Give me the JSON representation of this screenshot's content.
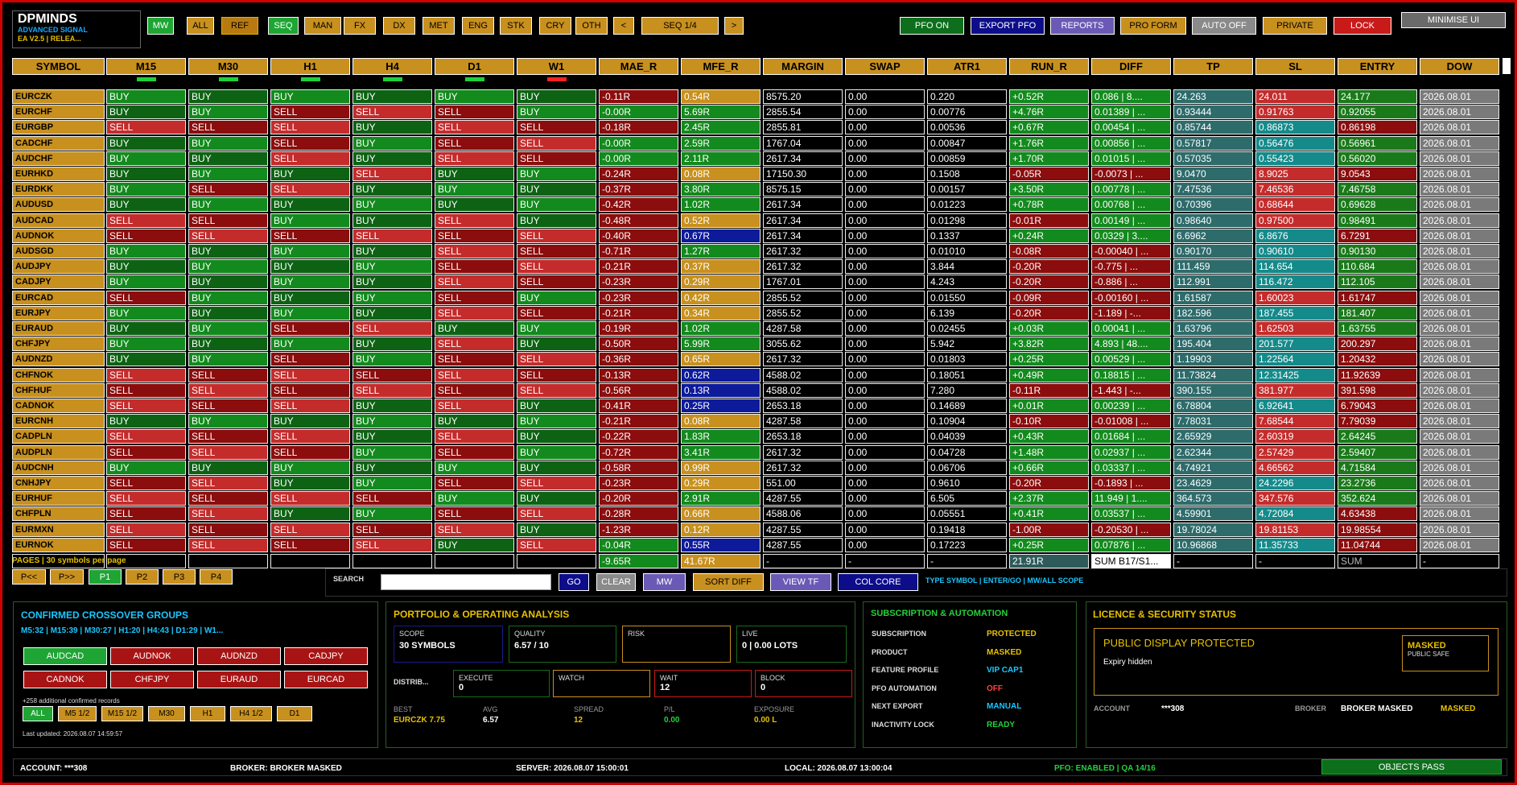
{
  "app": {
    "name": "DPMINDS",
    "sub": "ADVANCED SIGNAL",
    "ver": "EA V2.5 | RELEA..."
  },
  "filters": [
    "MW",
    "ALL",
    "REF",
    "SEQ",
    "MAN",
    "FX",
    "DX",
    "MET",
    "ENG",
    "STK",
    "CRY",
    "OTH",
    "<",
    "SEQ 1/4",
    ">"
  ],
  "toolbar": {
    "pfo": "PFO ON",
    "export": "EXPORT PFO",
    "reports": "REPORTS",
    "proform": "PRO FORM",
    "auto": "AUTO OFF",
    "private": "PRIVATE",
    "lock": "LOCK",
    "minimise": "MINIMISE UI"
  },
  "columns": [
    "SYMBOL",
    "M15",
    "M30",
    "H1",
    "H4",
    "D1",
    "W1",
    "MAE_R",
    "MFE_R",
    "MARGIN",
    "SWAP",
    "ATR1",
    "RUN_R",
    "DIFF",
    "TP",
    "SL",
    "ENTRY",
    "DOW"
  ],
  "indicators": [
    "green",
    "green",
    "green",
    "green",
    "green",
    "red"
  ],
  "rows": [
    [
      "EURCZK",
      "B",
      "B",
      "B",
      "B",
      "B",
      "B",
      "-0.11R",
      "0.54R",
      "8575.20",
      "0.00",
      "0.220",
      "+0.52R",
      "0.086 | 8....",
      "24.263",
      "24.011",
      "24.177",
      "2026.08.01"
    ],
    [
      "EURCHF",
      "B",
      "B",
      "S",
      "S",
      "S",
      "B",
      "-0.00R",
      "5.69R",
      "2855.54",
      "0.00",
      "0.00776",
      "+4.76R",
      "0.01389 | ...",
      "0.93444",
      "0.91763",
      "0.92055",
      "2026.08.01"
    ],
    [
      "EURGBP",
      "S",
      "S",
      "S",
      "B",
      "S",
      "S",
      "-0.18R",
      "2.45R",
      "2855.81",
      "0.00",
      "0.00536",
      "+0.67R",
      "0.00454 | ...",
      "0.85744",
      "0.86873",
      "0.86198",
      "2026.08.01"
    ],
    [
      "CADCHF",
      "B",
      "B",
      "S",
      "B",
      "S",
      "S",
      "-0.00R",
      "2.59R",
      "1767.04",
      "0.00",
      "0.00847",
      "+1.76R",
      "0.00856 | ...",
      "0.57817",
      "0.56476",
      "0.56961",
      "2026.08.01"
    ],
    [
      "AUDCHF",
      "B",
      "B",
      "S",
      "B",
      "S",
      "S",
      "-0.00R",
      "2.11R",
      "2617.34",
      "0.00",
      "0.00859",
      "+1.70R",
      "0.01015 | ...",
      "0.57035",
      "0.55423",
      "0.56020",
      "2026.08.01"
    ],
    [
      "EURHKD",
      "B",
      "B",
      "B",
      "S",
      "B",
      "B",
      "-0.24R",
      "0.08R",
      "17150.30",
      "0.00",
      "0.1508",
      "-0.05R",
      "-0.0073 | ...",
      "9.0470",
      "8.9025",
      "9.0543",
      "2026.08.01"
    ],
    [
      "EURDKK",
      "B",
      "S",
      "S",
      "B",
      "B",
      "B",
      "-0.37R",
      "3.80R",
      "8575.15",
      "0.00",
      "0.00157",
      "+3.50R",
      "0.00778 | ...",
      "7.47536",
      "7.46536",
      "7.46758",
      "2026.08.01"
    ],
    [
      "AUDUSD",
      "B",
      "B",
      "B",
      "B",
      "B",
      "B",
      "-0.42R",
      "1.02R",
      "2617.34",
      "0.00",
      "0.01223",
      "+0.78R",
      "0.00768 | ...",
      "0.70396",
      "0.68644",
      "0.69628",
      "2026.08.01"
    ],
    [
      "AUDCAD",
      "S",
      "S",
      "B",
      "B",
      "S",
      "B",
      "-0.48R",
      "0.52R",
      "2617.34",
      "0.00",
      "0.01298",
      "-0.01R",
      "0.00149 | ...",
      "0.98640",
      "0.97500",
      "0.98491",
      "2026.08.01"
    ],
    [
      "AUDNOK",
      "S",
      "S",
      "S",
      "S",
      "S",
      "S",
      "-0.40R",
      "0.67R",
      "2617.34",
      "0.00",
      "0.1337",
      "+0.24R",
      "0.0329 | 3....",
      "6.6962",
      "6.8676",
      "6.7291",
      "2026.08.01"
    ],
    [
      "AUDSGD",
      "B",
      "B",
      "B",
      "B",
      "S",
      "S",
      "-0.71R",
      "1.27R",
      "2617.32",
      "0.00",
      "0.01010",
      "-0.08R",
      "-0.00040 | ...",
      "0.90170",
      "0.90610",
      "0.90130",
      "2026.08.01"
    ],
    [
      "AUDJPY",
      "B",
      "B",
      "B",
      "B",
      "S",
      "S",
      "-0.21R",
      "0.37R",
      "2617.32",
      "0.00",
      "3.844",
      "-0.20R",
      "-0.775 | ...",
      "111.459",
      "114.654",
      "110.684",
      "2026.08.01"
    ],
    [
      "CADJPY",
      "B",
      "B",
      "B",
      "B",
      "S",
      "S",
      "-0.23R",
      "0.29R",
      "1767.01",
      "0.00",
      "4.243",
      "-0.20R",
      "-0.886 | ...",
      "112.991",
      "116.472",
      "112.105",
      "2026.08.01"
    ],
    [
      "EURCAD",
      "S",
      "B",
      "B",
      "B",
      "S",
      "B",
      "-0.23R",
      "0.42R",
      "2855.52",
      "0.00",
      "0.01550",
      "-0.09R",
      "-0.00160 | ...",
      "1.61587",
      "1.60023",
      "1.61747",
      "2026.08.01"
    ],
    [
      "EURJPY",
      "B",
      "B",
      "B",
      "B",
      "S",
      "S",
      "-0.21R",
      "0.34R",
      "2855.52",
      "0.00",
      "6.139",
      "-0.20R",
      "-1.189 | -...",
      "182.596",
      "187.455",
      "181.407",
      "2026.08.01"
    ],
    [
      "EURAUD",
      "B",
      "B",
      "S",
      "S",
      "B",
      "B",
      "-0.19R",
      "1.02R",
      "4287.58",
      "0.00",
      "0.02455",
      "+0.03R",
      "0.00041 | ...",
      "1.63796",
      "1.62503",
      "1.63755",
      "2026.08.01"
    ],
    [
      "CHFJPY",
      "B",
      "B",
      "B",
      "B",
      "S",
      "B",
      "-0.50R",
      "5.99R",
      "3055.62",
      "0.00",
      "5.942",
      "+3.82R",
      "4.893 | 48....",
      "195.404",
      "201.577",
      "200.297",
      "2026.08.01"
    ],
    [
      "AUDNZD",
      "B",
      "B",
      "S",
      "B",
      "S",
      "S",
      "-0.36R",
      "0.65R",
      "2617.32",
      "0.00",
      "0.01803",
      "+0.25R",
      "0.00529 | ...",
      "1.19903",
      "1.22564",
      "1.20432",
      "2026.08.01"
    ],
    [
      "CHFNOK",
      "S",
      "S",
      "S",
      "S",
      "S",
      "S",
      "-0.13R",
      "0.62R",
      "4588.02",
      "0.00",
      "0.18051",
      "+0.49R",
      "0.18815 | ...",
      "11.73824",
      "12.31425",
      "11.92639",
      "2026.08.01"
    ],
    [
      "CHFHUF",
      "S",
      "S",
      "S",
      "S",
      "S",
      "S",
      "-0.56R",
      "0.13R",
      "4588.02",
      "0.00",
      "7.280",
      "-0.11R",
      "-1.443 | -...",
      "390.155",
      "381.977",
      "391.598",
      "2026.08.01"
    ],
    [
      "CADNOK",
      "S",
      "S",
      "S",
      "B",
      "S",
      "B",
      "-0.41R",
      "0.25R",
      "2653.18",
      "0.00",
      "0.14689",
      "+0.01R",
      "0.00239 | ...",
      "6.78804",
      "6.92641",
      "6.79043",
      "2026.08.01"
    ],
    [
      "EURCNH",
      "B",
      "B",
      "B",
      "B",
      "B",
      "B",
      "-0.21R",
      "0.08R",
      "4287.58",
      "0.00",
      "0.10904",
      "-0.10R",
      "-0.01008 | ...",
      "7.78031",
      "7.68544",
      "7.79039",
      "2026.08.01"
    ],
    [
      "CADPLN",
      "S",
      "S",
      "S",
      "B",
      "S",
      "B",
      "-0.22R",
      "1.83R",
      "2653.18",
      "0.00",
      "0.04039",
      "+0.43R",
      "0.01684 | ...",
      "2.65929",
      "2.60319",
      "2.64245",
      "2026.08.01"
    ],
    [
      "AUDPLN",
      "S",
      "S",
      "S",
      "B",
      "S",
      "B",
      "-0.72R",
      "3.41R",
      "2617.32",
      "0.00",
      "0.04728",
      "+1.48R",
      "0.02937 | ...",
      "2.62344",
      "2.57429",
      "2.59407",
      "2026.08.01"
    ],
    [
      "AUDCNH",
      "B",
      "B",
      "B",
      "B",
      "B",
      "B",
      "-0.58R",
      "0.99R",
      "2617.32",
      "0.00",
      "0.06706",
      "+0.66R",
      "0.03337 | ...",
      "4.74921",
      "4.66562",
      "4.71584",
      "2026.08.01"
    ],
    [
      "CNHJPY",
      "S",
      "S",
      "B",
      "B",
      "S",
      "S",
      "-0.23R",
      "0.29R",
      "551.00",
      "0.00",
      "0.9610",
      "-0.20R",
      "-0.1893 | ...",
      "23.4629",
      "24.2296",
      "23.2736",
      "2026.08.01"
    ],
    [
      "EURHUF",
      "S",
      "S",
      "S",
      "S",
      "B",
      "B",
      "-0.20R",
      "2.91R",
      "4287.55",
      "0.00",
      "6.505",
      "+2.37R",
      "11.949 | 1....",
      "364.573",
      "347.576",
      "352.624",
      "2026.08.01"
    ],
    [
      "CHFPLN",
      "S",
      "S",
      "B",
      "B",
      "S",
      "S",
      "-0.28R",
      "0.66R",
      "4588.06",
      "0.00",
      "0.05551",
      "+0.41R",
      "0.03537 | ...",
      "4.59901",
      "4.72084",
      "4.63438",
      "2026.08.01"
    ],
    [
      "EURMXN",
      "S",
      "S",
      "S",
      "S",
      "S",
      "B",
      "-1.23R",
      "0.12R",
      "4287.55",
      "0.00",
      "0.19418",
      "-1.00R",
      "-0.20530 | ...",
      "19.78024",
      "19.81153",
      "19.98554",
      "2026.08.01"
    ],
    [
      "EURNOK",
      "S",
      "S",
      "S",
      "S",
      "B",
      "S",
      "-0.04R",
      "0.55R",
      "4287.55",
      "0.00",
      "0.17223",
      "+0.25R",
      "0.07876 | ...",
      "10.96868",
      "11.35733",
      "11.04744",
      "2026.08.01"
    ]
  ],
  "mfe_blue": [
    9,
    18,
    19,
    20,
    29
  ],
  "sl_teal": [
    2,
    3,
    4,
    9,
    10,
    11,
    12,
    14,
    16,
    17,
    18,
    20,
    25,
    27,
    29
  ],
  "tp_teal": [
    0,
    1,
    2,
    3,
    4,
    5,
    6,
    7,
    8,
    9,
    10,
    11,
    12,
    13,
    14,
    15,
    16,
    17,
    18,
    19,
    20,
    21,
    22,
    23,
    24,
    25,
    26,
    27,
    28,
    29
  ],
  "totals": [
    "",
    "",
    "",
    "",
    "",
    "",
    "",
    "-9.65R",
    "41.67R",
    "-",
    "-",
    "-",
    "21.91R",
    "SUM B17/S1...",
    "-",
    "-",
    "SUM",
    "-"
  ],
  "signal": {
    "B": "BUY",
    "S": "SELL"
  },
  "pages": {
    "label": "PAGES | 30 symbols per page",
    "prev": "P<<",
    "next": "P>>",
    "items": [
      "P1",
      "P2",
      "P3",
      "P4"
    ]
  },
  "search": {
    "label": "SEARCH",
    "placeholder": "",
    "go": "GO",
    "clear": "CLEAR",
    "mw": "MW",
    "sort": "SORT DIFF",
    "viewtf": "VIEW TF",
    "colcore": "COL CORE",
    "hint": "TYPE SYMBOL | ENTER/GO | MW/ALL SCOPE"
  },
  "crossover": {
    "title": "CONFIRMED CROSSOVER GROUPS",
    "summary": "M5:32 | M15:39 | M30:27 | H1:20 | H4:43 | D1:29 | W1...",
    "symbols": [
      "AUDCAD",
      "AUDNOK",
      "AUDNZD",
      "CADJPY",
      "CADNOK",
      "CHFJPY",
      "EURAUD",
      "EURCAD"
    ],
    "more": "+258 additional confirmed records",
    "tf": [
      "ALL",
      "M5 1/2",
      "M15 1/2",
      "M30",
      "H1",
      "H4 1/2",
      "D1"
    ],
    "updated": "Last updated: 2026.08.07 14:59:57"
  },
  "portfolio": {
    "title": "PORTFOLIO & OPERATING ANALYSIS",
    "scope_l": "SCOPE",
    "scope_v": "30 SYMBOLS",
    "quality_l": "QUALITY",
    "quality_v": "6.57 / 10",
    "risk_l": "RISK",
    "risk_v": "",
    "live_l": "LIVE",
    "live_v": "0 | 0.00 LOTS",
    "distrib": "DISTRIB...",
    "execute_l": "EXECUTE",
    "execute_v": "0",
    "watch_l": "WATCH",
    "watch_v": "",
    "wait_l": "WAIT",
    "wait_v": "12",
    "block_l": "BLOCK",
    "block_v": "0",
    "best_l": "BEST",
    "best_v": "EURCZK 7.75",
    "avg_l": "AVG",
    "avg_v": "6.57",
    "spread_l": "SPREAD",
    "spread_v": "12",
    "pl_l": "P/L",
    "pl_v": "0.00",
    "exp_l": "EXPOSURE",
    "exp_v": "0.00 L"
  },
  "subscription": {
    "title": "SUBSCRIPTION & AUTOMATION",
    "rows": [
      [
        "SUBSCRIPTION",
        "PROTECTED",
        "#e7c100"
      ],
      [
        "PRODUCT",
        "MASKED",
        "#e7c100"
      ],
      [
        "FEATURE PROFILE",
        "VIP CAP1",
        "#19c8ff"
      ],
      [
        "PFO AUTOMATION",
        "OFF",
        "#ff4040"
      ],
      [
        "NEXT EXPORT",
        "MANUAL",
        "#19c8ff"
      ],
      [
        "INACTIVITY LOCK",
        "READY",
        "#23d13a"
      ]
    ]
  },
  "licence": {
    "title": "LICENCE & SECURITY STATUS",
    "headline": "PUBLIC DISPLAY PROTECTED",
    "expiry": "Expiry hidden",
    "masked": "MASKED",
    "safe": "PUBLIC SAFE",
    "account_l": "ACCOUNT",
    "account_v": "***308",
    "broker_l": "BROKER",
    "broker_v": "BROKER MASKED",
    "broker_s": "MASKED"
  },
  "status": {
    "account": "ACCOUNT: ***308",
    "broker": "BROKER: BROKER MASKED",
    "server": "SERVER: 2026.08.07 15:00:01",
    "local": "LOCAL: 2026.08.07 13:00:04",
    "pfo": "PFO: ENABLED | QA 14/16",
    "objects": "OBJECTS PASS"
  },
  "colors": {
    "buy_a": "#138a1d",
    "buy_b": "#0d6313",
    "sell_a": "#c42c2c",
    "sell_b": "#8b0d0d",
    "gold": "#c8901e",
    "teal": "#158a8a",
    "blue": "#0d1a9a"
  }
}
